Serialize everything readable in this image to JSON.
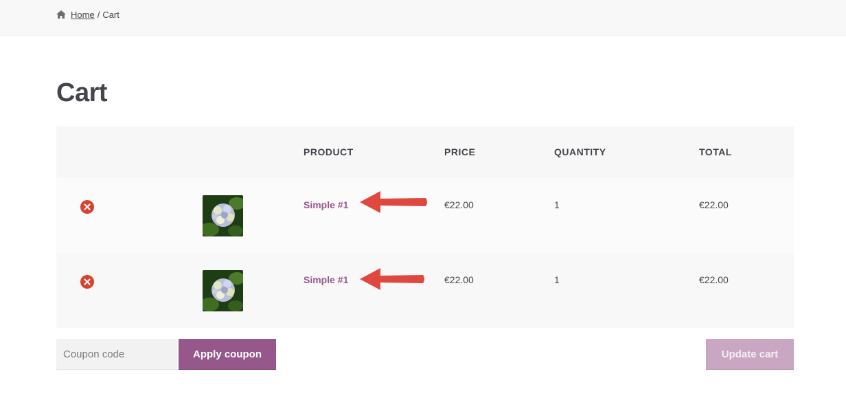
{
  "breadcrumb": {
    "home_label": "Home",
    "separator": "/",
    "current": "Cart"
  },
  "page": {
    "title": "Cart"
  },
  "table": {
    "headers": {
      "product": "PRODUCT",
      "price": "PRICE",
      "quantity": "QUANTITY",
      "total": "TOTAL"
    },
    "rows": [
      {
        "product": "Simple #1",
        "price": "€22.00",
        "quantity": "1",
        "total": "€22.00"
      },
      {
        "product": "Simple #1",
        "price": "€22.00",
        "quantity": "1",
        "total": "€22.00"
      }
    ]
  },
  "coupon": {
    "placeholder": "Coupon code",
    "apply_label": "Apply coupon"
  },
  "actions": {
    "update_label": "Update cart"
  },
  "colors": {
    "accent": "#96588a",
    "remove": "#d9412f",
    "annotation_arrow": "#e0483f",
    "update_disabled": "#c9a7c2"
  }
}
